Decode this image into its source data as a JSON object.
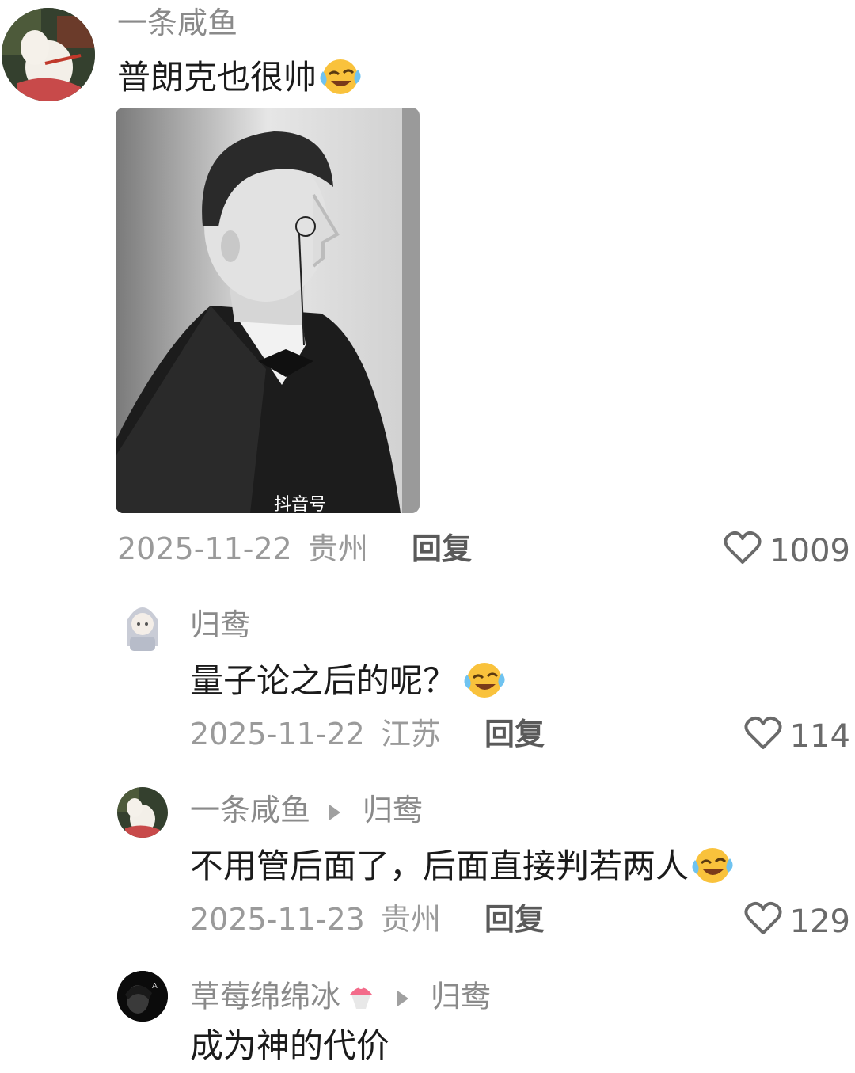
{
  "comments": [
    {
      "user": "一条咸鱼",
      "text": "普朗克也很帅",
      "emoji": "laughing-crying",
      "image_watermark": "抖音号",
      "date": "2025-11-22",
      "location": "贵州",
      "reply_label": "回复",
      "likes": "1009"
    },
    {
      "user": "归鸯",
      "text": "量子论之后的呢？",
      "emoji": "laughing-crying",
      "date": "2025-11-22",
      "location": "江苏",
      "reply_label": "回复",
      "likes": "114"
    },
    {
      "user": "一条咸鱼",
      "reply_to": "归鸯",
      "text": "不用管后面了，后面直接判若两人",
      "emoji": "laughing-crying",
      "date": "2025-11-23",
      "location": "贵州",
      "reply_label": "回复",
      "likes": "129"
    },
    {
      "user": "草莓绵绵冰",
      "user_emoji": "shaved-ice",
      "reply_to": "归鸯",
      "text": "成为神的代价"
    }
  ],
  "colors": {
    "username": "#8a8a8a",
    "meta": "#9a9a9a",
    "text": "#1b1b1b"
  }
}
